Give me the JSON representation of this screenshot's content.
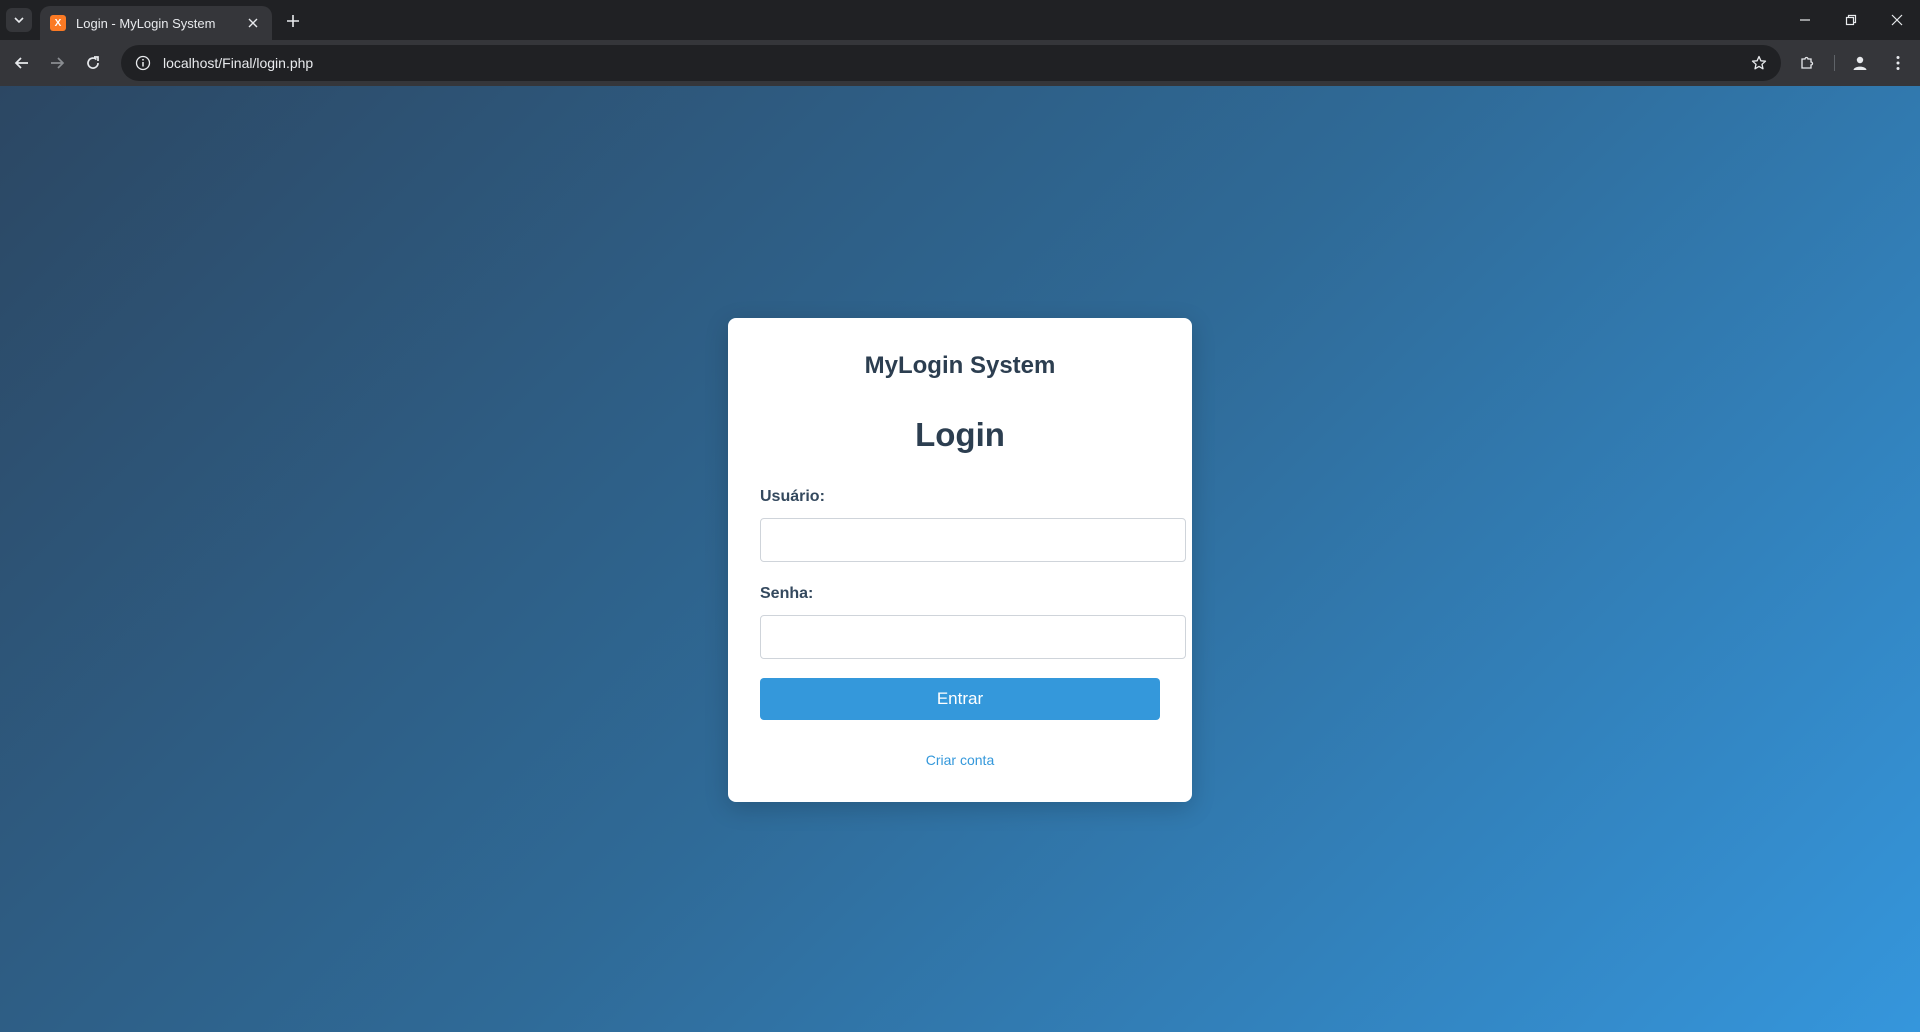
{
  "browser": {
    "tab_title": "Login - MyLogin System",
    "favicon_letter": "X",
    "url": "localhost/Final/login.php"
  },
  "page": {
    "brand": "MyLogin System",
    "heading": "Login",
    "username_label": "Usuário:",
    "username_value": "",
    "password_label": "Senha:",
    "password_value": "",
    "submit_label": "Entrar",
    "register_link": "Criar conta"
  },
  "colors": {
    "accent": "#3498db",
    "heading_text": "#2c3e50",
    "background_start": "#2c4763",
    "background_end": "#3596dc"
  }
}
